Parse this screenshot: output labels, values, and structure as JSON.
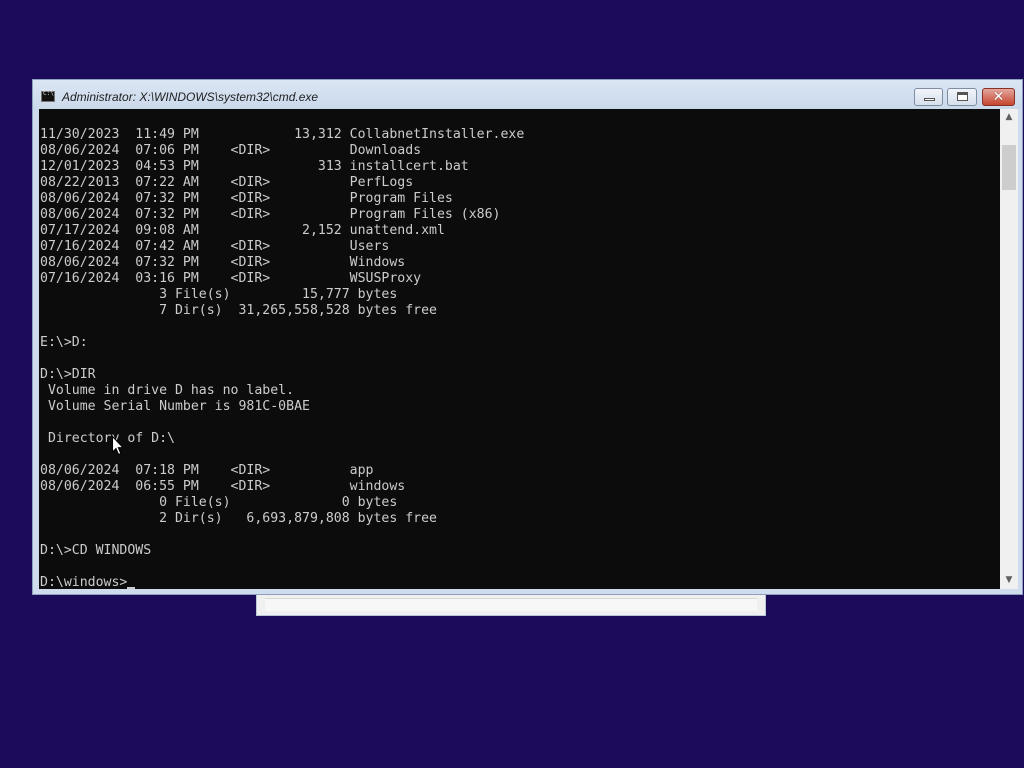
{
  "window": {
    "title": "Administrator: X:\\WINDOWS\\system32\\cmd.exe",
    "icon": "cmd-icon",
    "buttons": {
      "minimize": "minimize-icon",
      "maximize": "maximize-icon",
      "close": "✕"
    }
  },
  "console": {
    "lines": [
      "11/30/2023  11:49 PM            13,312 CollabnetInstaller.exe",
      "08/06/2024  07:06 PM    <DIR>          Downloads",
      "12/01/2023  04:53 PM               313 installcert.bat",
      "08/22/2013  07:22 AM    <DIR>          PerfLogs",
      "08/06/2024  07:32 PM    <DIR>          Program Files",
      "08/06/2024  07:32 PM    <DIR>          Program Files (x86)",
      "07/17/2024  09:08 AM             2,152 unattend.xml",
      "07/16/2024  07:42 AM    <DIR>          Users",
      "08/06/2024  07:32 PM    <DIR>          Windows",
      "07/16/2024  03:16 PM    <DIR>          WSUSProxy",
      "               3 File(s)         15,777 bytes",
      "               7 Dir(s)  31,265,558,528 bytes free",
      "",
      "E:\\>D:",
      "",
      "D:\\>DIR",
      " Volume in drive D has no label.",
      " Volume Serial Number is 981C-0BAE",
      "",
      " Directory of D:\\",
      "",
      "08/06/2024  07:18 PM    <DIR>          app",
      "08/06/2024  06:55 PM    <DIR>          windows",
      "               0 File(s)              0 bytes",
      "               2 Dir(s)   6,693,879,808 bytes free",
      "",
      "D:\\>CD WINDOWS",
      ""
    ],
    "prompt": "D:\\windows>"
  },
  "scrollbar": {
    "up_arrow": "▲",
    "down_arrow": "▼"
  },
  "colors": {
    "desktop": "#1c0a5a",
    "console_bg": "#0c0c0c",
    "console_fg": "#cccccc",
    "close_button": "#c5452f"
  }
}
